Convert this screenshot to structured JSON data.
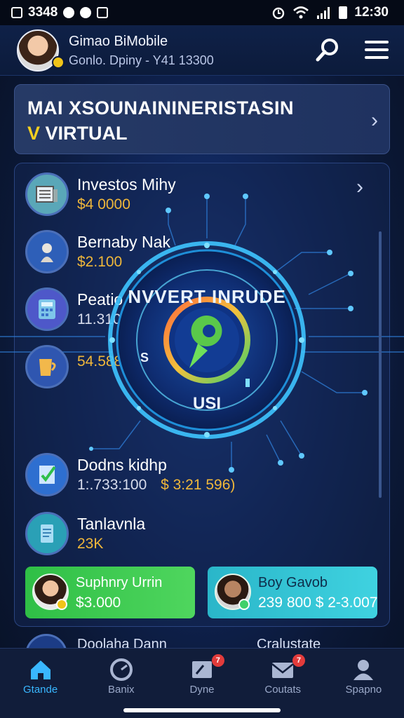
{
  "status_bar": {
    "left_text": "3348",
    "time": "12:30"
  },
  "header": {
    "user_name": "Gimao BiMobile",
    "user_sub": "Gonlo. Dpiny - Y41 13300",
    "icons": [
      "search-icon",
      "menu-icon"
    ]
  },
  "promo": {
    "title": "MAI XSOUNAININERISTASIN",
    "sub_prefix": "V",
    "sub_text": "VIRTUAL"
  },
  "list": {
    "items": [
      {
        "title": "Investos Mihy",
        "value": "$4 0000",
        "icon": "server-icon",
        "icon_bg": "#5aa7b8"
      },
      {
        "title": "Bernaby Nak",
        "value": "$2.100",
        "icon": "bust-icon",
        "icon_bg": "#2e5fb8"
      },
      {
        "title": "Peatio",
        "value": "11.310",
        "icon": "calculator-icon",
        "icon_bg": "#4e58c9"
      },
      {
        "title": "",
        "value": "54.588",
        "icon": "cup-icon",
        "icon_bg": "#2f56b0"
      },
      {
        "title": "Dodns kidhp",
        "value": "1:.733:100",
        "value2": "$ 3:21 596)",
        "icon": "checklist-icon",
        "icon_bg": "#2e6fd0"
      },
      {
        "title": "Tanlavnla",
        "value": "23K",
        "icon": "document-icon",
        "icon_bg": "#2aa0b6"
      }
    ]
  },
  "orb": {
    "top_text": "NVVERT INRUDE",
    "bottom_text": "USI",
    "left_char": "S"
  },
  "cards": [
    {
      "title": "Suphnry Urrin",
      "value": "$3.000",
      "color": "#39c94f"
    },
    {
      "title": "Boy Gavob",
      "value": "239 800  $ 2-3.007",
      "color": "#33c4d6"
    }
  ],
  "peek": {
    "title": "Doolaha Dann",
    "right": "Cralustate"
  },
  "bottom_nav": {
    "items": [
      {
        "label": "Gtande",
        "icon": "home-icon",
        "active": true
      },
      {
        "label": "Banix",
        "icon": "gauge-icon",
        "active": false
      },
      {
        "label": "Dyne",
        "icon": "message-icon",
        "badge": "7",
        "active": false
      },
      {
        "label": "Coutats",
        "icon": "mail-icon",
        "badge": "7",
        "active": false
      },
      {
        "label": "Spapno",
        "icon": "profile-icon",
        "active": false
      }
    ]
  },
  "colors": {
    "accent": "#39b7ff",
    "value_gold": "#f0b73a",
    "background": "#0b1836"
  }
}
